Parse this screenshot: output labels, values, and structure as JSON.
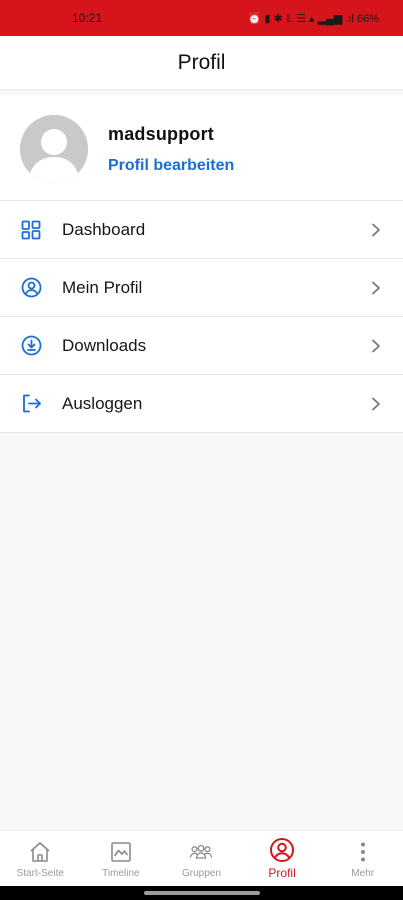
{
  "status_bar": {
    "time": "10:21",
    "indicators": "⏰ ▮ ✱ 𝕃 ☰ ▴ ▂▄▆ .ıl 66%"
  },
  "app_bar": {
    "title": "Profil"
  },
  "profile": {
    "username": "madsupport",
    "edit_label": "Profil bearbeiten"
  },
  "menu": {
    "items": [
      {
        "label": "Dashboard",
        "icon": "dashboard-icon"
      },
      {
        "label": "Mein Profil",
        "icon": "user-circle-icon"
      },
      {
        "label": "Downloads",
        "icon": "download-icon"
      },
      {
        "label": "Ausloggen",
        "icon": "logout-icon"
      }
    ]
  },
  "bottom_nav": {
    "items": [
      {
        "label": "Start-Seite",
        "icon": "home-icon"
      },
      {
        "label": "Timeline",
        "icon": "timeline-icon"
      },
      {
        "label": "Gruppen",
        "icon": "groups-icon"
      },
      {
        "label": "Profil",
        "icon": "profile-icon",
        "active": true
      },
      {
        "label": "Mehr",
        "icon": "more-icon"
      }
    ]
  },
  "colors": {
    "brand_red": "#d6141b",
    "link_blue": "#1a6fd1",
    "icon_blue": "#1a6fd1"
  }
}
